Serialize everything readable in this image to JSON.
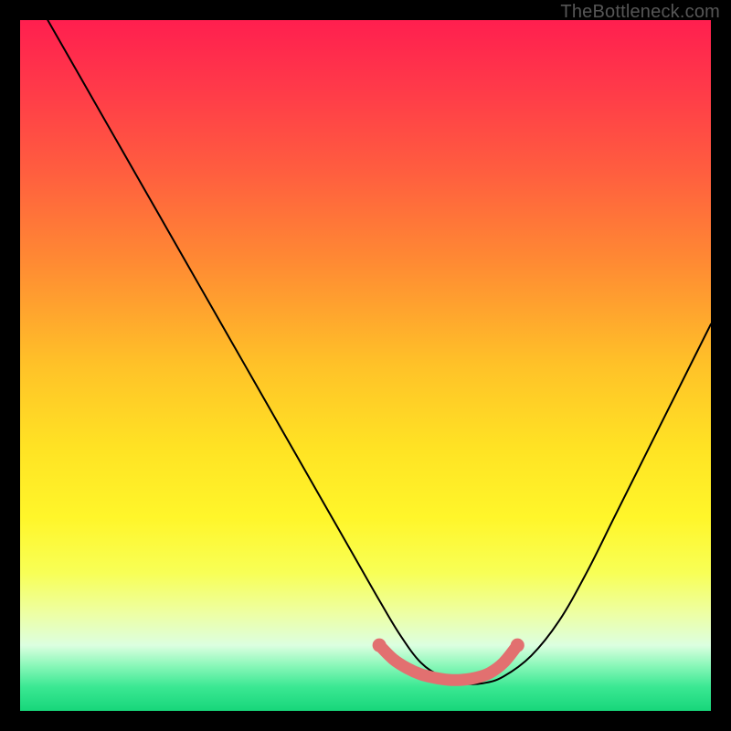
{
  "watermark": "TheBottleneck.com",
  "gradient_stops": [
    {
      "offset": 0.0,
      "color": "#ff1f4f"
    },
    {
      "offset": 0.1,
      "color": "#ff3a49"
    },
    {
      "offset": 0.22,
      "color": "#ff5e3f"
    },
    {
      "offset": 0.35,
      "color": "#ff8a33"
    },
    {
      "offset": 0.5,
      "color": "#ffc228"
    },
    {
      "offset": 0.62,
      "color": "#ffe324"
    },
    {
      "offset": 0.72,
      "color": "#fff62a"
    },
    {
      "offset": 0.8,
      "color": "#f8ff56"
    },
    {
      "offset": 0.86,
      "color": "#edffa5"
    },
    {
      "offset": 0.905,
      "color": "#dcffe0"
    },
    {
      "offset": 0.935,
      "color": "#88f7b8"
    },
    {
      "offset": 0.965,
      "color": "#3be893"
    },
    {
      "offset": 1.0,
      "color": "#17d67a"
    }
  ],
  "chart_data": {
    "type": "line",
    "title": "",
    "xlabel": "",
    "ylabel": "",
    "xlim": [
      0,
      100
    ],
    "ylim": [
      0,
      100
    ],
    "series": [
      {
        "name": "bottleneck-curve",
        "color": "#000000",
        "x": [
          4,
          8,
          12,
          16,
          20,
          24,
          28,
          32,
          36,
          40,
          44,
          48,
          52,
          55,
          58,
          61,
          64,
          67,
          70,
          74,
          78,
          82,
          86,
          90,
          94,
          98,
          100
        ],
        "y": [
          100,
          93,
          86,
          79,
          72,
          65,
          58,
          51,
          44,
          37,
          30,
          23,
          16,
          11,
          7,
          5,
          4,
          4,
          5,
          8,
          13,
          20,
          28,
          36,
          44,
          52,
          56
        ]
      },
      {
        "name": "optimal-zone-marker",
        "color": "#e27070",
        "x": [
          52,
          54,
          56,
          58,
          60,
          62,
          64,
          66,
          68,
          70,
          72
        ],
        "y": [
          9.5,
          7.5,
          6.2,
          5.3,
          4.8,
          4.5,
          4.5,
          4.8,
          5.5,
          7.0,
          9.5
        ]
      }
    ]
  }
}
